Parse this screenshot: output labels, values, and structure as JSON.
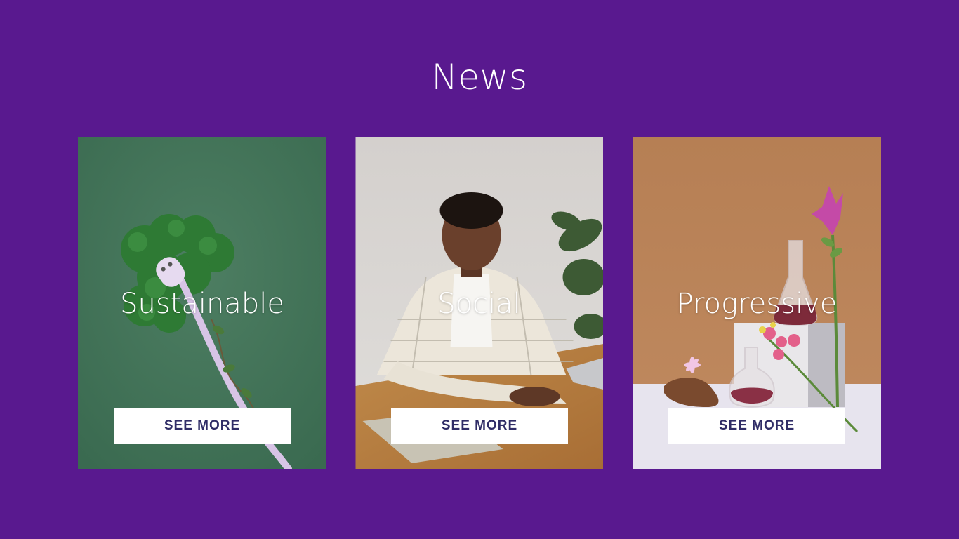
{
  "page": {
    "title": "News",
    "background_color": "#59198f"
  },
  "cards": [
    {
      "title": "Sustainable",
      "button_label": "SEE MORE",
      "image_subject": "plug-with-moss-image"
    },
    {
      "title": "Social",
      "button_label": "SEE MORE",
      "image_subject": "man-at-desk-image"
    },
    {
      "title": "Progressive",
      "button_label": "SEE MORE",
      "image_subject": "lab-flasks-flowers-image"
    }
  ],
  "colors": {
    "button_bg": "#ffffff",
    "button_text": "#2f2c66",
    "title_text": "#ffffff"
  }
}
